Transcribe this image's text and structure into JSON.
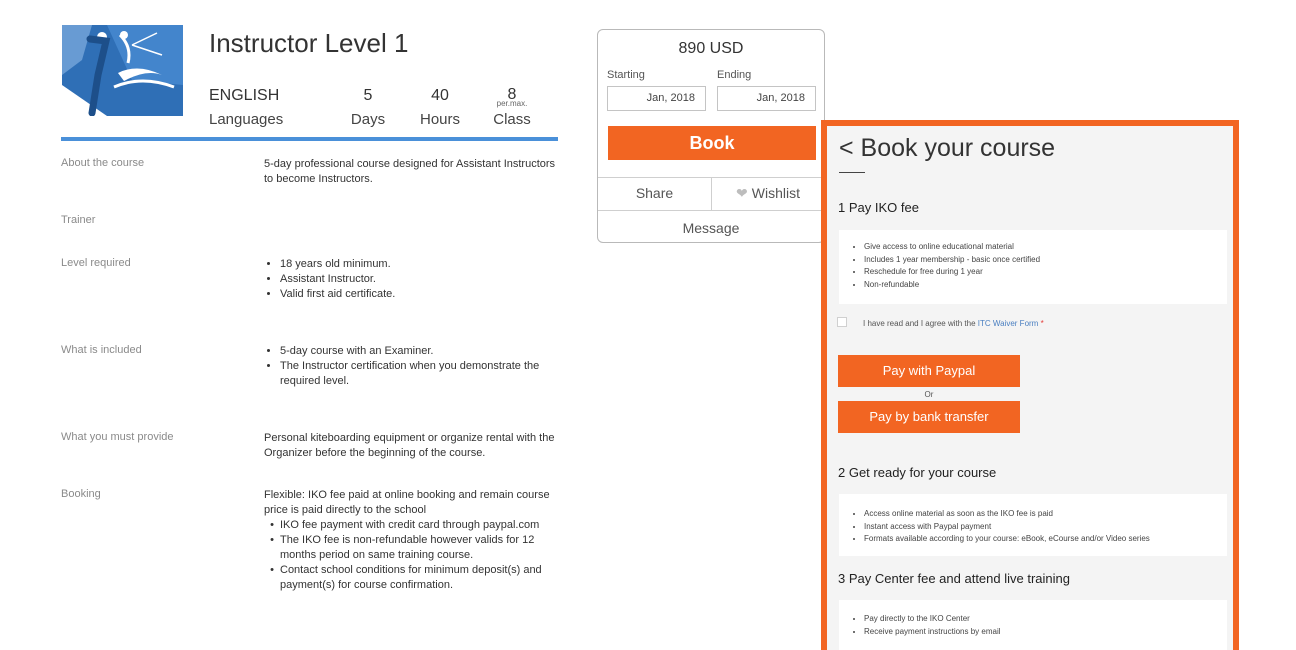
{
  "course": {
    "title": "Instructor Level 1",
    "stats": {
      "languages": {
        "value": "ENGLISH",
        "label": "Languages"
      },
      "days": {
        "value": "5",
        "label": "Days"
      },
      "hours": {
        "value": "40",
        "label": "Hours"
      },
      "class": {
        "value": "8",
        "sub": "per.max.",
        "label": "Class"
      }
    }
  },
  "details": {
    "about": {
      "label": "About the course",
      "text": "5-day professional course designed for Assistant Instructors to become Instructors."
    },
    "trainer": {
      "label": "Trainer"
    },
    "level": {
      "label": "Level required",
      "items": [
        "18 years old minimum.",
        "Assistant Instructor.",
        "Valid first aid certificate."
      ]
    },
    "included": {
      "label": "What is included",
      "items": [
        "5-day course with an Examiner.",
        "The Instructor certification when you demonstrate the required level."
      ]
    },
    "provide": {
      "label": "What you must provide",
      "text": "Personal kiteboarding equipment or organize rental with the Organizer before the beginning of the course."
    },
    "booking": {
      "label": "Booking",
      "text": "Flexible: IKO fee paid at online booking and remain course price is paid directly to the school",
      "items": [
        "IKO fee payment with credit card through paypal.com",
        "The IKO fee is non-refundable however valids for 12 months period on same training course.",
        "Contact school conditions for minimum deposit(s) and payment(s) for course confirmation."
      ]
    }
  },
  "card": {
    "price": "890 USD",
    "starting_label": "Starting",
    "ending_label": "Ending",
    "start_date": "Jan, 2018",
    "end_date": "Jan, 2018",
    "book_label": "Book",
    "share_label": "Share",
    "wishlist_label": "Wishlist",
    "message_label": "Message"
  },
  "panel": {
    "title": "< Book your course",
    "step1": {
      "title": "1 Pay IKO fee",
      "items": [
        "Give access to online educational material",
        "Includes 1 year membership - basic once certified",
        "Reschedule for free during 1 year",
        "Non-refundable"
      ]
    },
    "agree": {
      "prefix": "I have read and I agree with the ",
      "link": "ITC Waiver Form",
      "required": " *"
    },
    "paypal_label": "Pay with Paypal",
    "or_label": "Or",
    "bank_label": "Pay by bank transfer",
    "step2": {
      "title": "2 Get ready for your course",
      "items": [
        "Access online material as soon as the IKO fee is paid",
        "Instant access with Paypal payment",
        "Formats available according to your course: eBook, eCourse and/or Video series"
      ]
    },
    "step3": {
      "title": "3 Pay Center fee and attend live training",
      "items": [
        "Pay directly to the IKO Center",
        "Receive payment instructions by email"
      ]
    }
  },
  "colors": {
    "accent": "#f26522",
    "blue": "#4a90d9"
  },
  "icons": {
    "logo": "kite-instructor-logo",
    "wishlist": "heart-icon"
  }
}
